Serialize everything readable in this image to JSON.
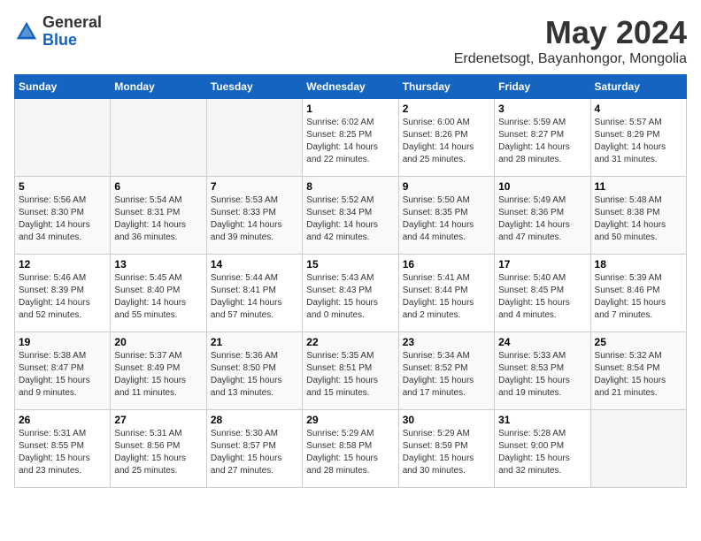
{
  "header": {
    "logo": {
      "line1": "General",
      "line2": "Blue"
    },
    "month": "May 2024",
    "location": "Erdenetsogt, Bayanhongor, Mongolia"
  },
  "weekdays": [
    "Sunday",
    "Monday",
    "Tuesday",
    "Wednesday",
    "Thursday",
    "Friday",
    "Saturday"
  ],
  "weeks": [
    [
      {
        "day": "",
        "empty": true
      },
      {
        "day": "",
        "empty": true
      },
      {
        "day": "",
        "empty": true
      },
      {
        "day": "1",
        "sunrise": "Sunrise: 6:02 AM",
        "sunset": "Sunset: 8:25 PM",
        "daylight": "Daylight: 14 hours and 22 minutes."
      },
      {
        "day": "2",
        "sunrise": "Sunrise: 6:00 AM",
        "sunset": "Sunset: 8:26 PM",
        "daylight": "Daylight: 14 hours and 25 minutes."
      },
      {
        "day": "3",
        "sunrise": "Sunrise: 5:59 AM",
        "sunset": "Sunset: 8:27 PM",
        "daylight": "Daylight: 14 hours and 28 minutes."
      },
      {
        "day": "4",
        "sunrise": "Sunrise: 5:57 AM",
        "sunset": "Sunset: 8:29 PM",
        "daylight": "Daylight: 14 hours and 31 minutes."
      }
    ],
    [
      {
        "day": "5",
        "sunrise": "Sunrise: 5:56 AM",
        "sunset": "Sunset: 8:30 PM",
        "daylight": "Daylight: 14 hours and 34 minutes."
      },
      {
        "day": "6",
        "sunrise": "Sunrise: 5:54 AM",
        "sunset": "Sunset: 8:31 PM",
        "daylight": "Daylight: 14 hours and 36 minutes."
      },
      {
        "day": "7",
        "sunrise": "Sunrise: 5:53 AM",
        "sunset": "Sunset: 8:33 PM",
        "daylight": "Daylight: 14 hours and 39 minutes."
      },
      {
        "day": "8",
        "sunrise": "Sunrise: 5:52 AM",
        "sunset": "Sunset: 8:34 PM",
        "daylight": "Daylight: 14 hours and 42 minutes."
      },
      {
        "day": "9",
        "sunrise": "Sunrise: 5:50 AM",
        "sunset": "Sunset: 8:35 PM",
        "daylight": "Daylight: 14 hours and 44 minutes."
      },
      {
        "day": "10",
        "sunrise": "Sunrise: 5:49 AM",
        "sunset": "Sunset: 8:36 PM",
        "daylight": "Daylight: 14 hours and 47 minutes."
      },
      {
        "day": "11",
        "sunrise": "Sunrise: 5:48 AM",
        "sunset": "Sunset: 8:38 PM",
        "daylight": "Daylight: 14 hours and 50 minutes."
      }
    ],
    [
      {
        "day": "12",
        "sunrise": "Sunrise: 5:46 AM",
        "sunset": "Sunset: 8:39 PM",
        "daylight": "Daylight: 14 hours and 52 minutes."
      },
      {
        "day": "13",
        "sunrise": "Sunrise: 5:45 AM",
        "sunset": "Sunset: 8:40 PM",
        "daylight": "Daylight: 14 hours and 55 minutes."
      },
      {
        "day": "14",
        "sunrise": "Sunrise: 5:44 AM",
        "sunset": "Sunset: 8:41 PM",
        "daylight": "Daylight: 14 hours and 57 minutes."
      },
      {
        "day": "15",
        "sunrise": "Sunrise: 5:43 AM",
        "sunset": "Sunset: 8:43 PM",
        "daylight": "Daylight: 15 hours and 0 minutes."
      },
      {
        "day": "16",
        "sunrise": "Sunrise: 5:41 AM",
        "sunset": "Sunset: 8:44 PM",
        "daylight": "Daylight: 15 hours and 2 minutes."
      },
      {
        "day": "17",
        "sunrise": "Sunrise: 5:40 AM",
        "sunset": "Sunset: 8:45 PM",
        "daylight": "Daylight: 15 hours and 4 minutes."
      },
      {
        "day": "18",
        "sunrise": "Sunrise: 5:39 AM",
        "sunset": "Sunset: 8:46 PM",
        "daylight": "Daylight: 15 hours and 7 minutes."
      }
    ],
    [
      {
        "day": "19",
        "sunrise": "Sunrise: 5:38 AM",
        "sunset": "Sunset: 8:47 PM",
        "daylight": "Daylight: 15 hours and 9 minutes."
      },
      {
        "day": "20",
        "sunrise": "Sunrise: 5:37 AM",
        "sunset": "Sunset: 8:49 PM",
        "daylight": "Daylight: 15 hours and 11 minutes."
      },
      {
        "day": "21",
        "sunrise": "Sunrise: 5:36 AM",
        "sunset": "Sunset: 8:50 PM",
        "daylight": "Daylight: 15 hours and 13 minutes."
      },
      {
        "day": "22",
        "sunrise": "Sunrise: 5:35 AM",
        "sunset": "Sunset: 8:51 PM",
        "daylight": "Daylight: 15 hours and 15 minutes."
      },
      {
        "day": "23",
        "sunrise": "Sunrise: 5:34 AM",
        "sunset": "Sunset: 8:52 PM",
        "daylight": "Daylight: 15 hours and 17 minutes."
      },
      {
        "day": "24",
        "sunrise": "Sunrise: 5:33 AM",
        "sunset": "Sunset: 8:53 PM",
        "daylight": "Daylight: 15 hours and 19 minutes."
      },
      {
        "day": "25",
        "sunrise": "Sunrise: 5:32 AM",
        "sunset": "Sunset: 8:54 PM",
        "daylight": "Daylight: 15 hours and 21 minutes."
      }
    ],
    [
      {
        "day": "26",
        "sunrise": "Sunrise: 5:31 AM",
        "sunset": "Sunset: 8:55 PM",
        "daylight": "Daylight: 15 hours and 23 minutes."
      },
      {
        "day": "27",
        "sunrise": "Sunrise: 5:31 AM",
        "sunset": "Sunset: 8:56 PM",
        "daylight": "Daylight: 15 hours and 25 minutes."
      },
      {
        "day": "28",
        "sunrise": "Sunrise: 5:30 AM",
        "sunset": "Sunset: 8:57 PM",
        "daylight": "Daylight: 15 hours and 27 minutes."
      },
      {
        "day": "29",
        "sunrise": "Sunrise: 5:29 AM",
        "sunset": "Sunset: 8:58 PM",
        "daylight": "Daylight: 15 hours and 28 minutes."
      },
      {
        "day": "30",
        "sunrise": "Sunrise: 5:29 AM",
        "sunset": "Sunset: 8:59 PM",
        "daylight": "Daylight: 15 hours and 30 minutes."
      },
      {
        "day": "31",
        "sunrise": "Sunrise: 5:28 AM",
        "sunset": "Sunset: 9:00 PM",
        "daylight": "Daylight: 15 hours and 32 minutes."
      },
      {
        "day": "",
        "empty": true
      }
    ]
  ]
}
